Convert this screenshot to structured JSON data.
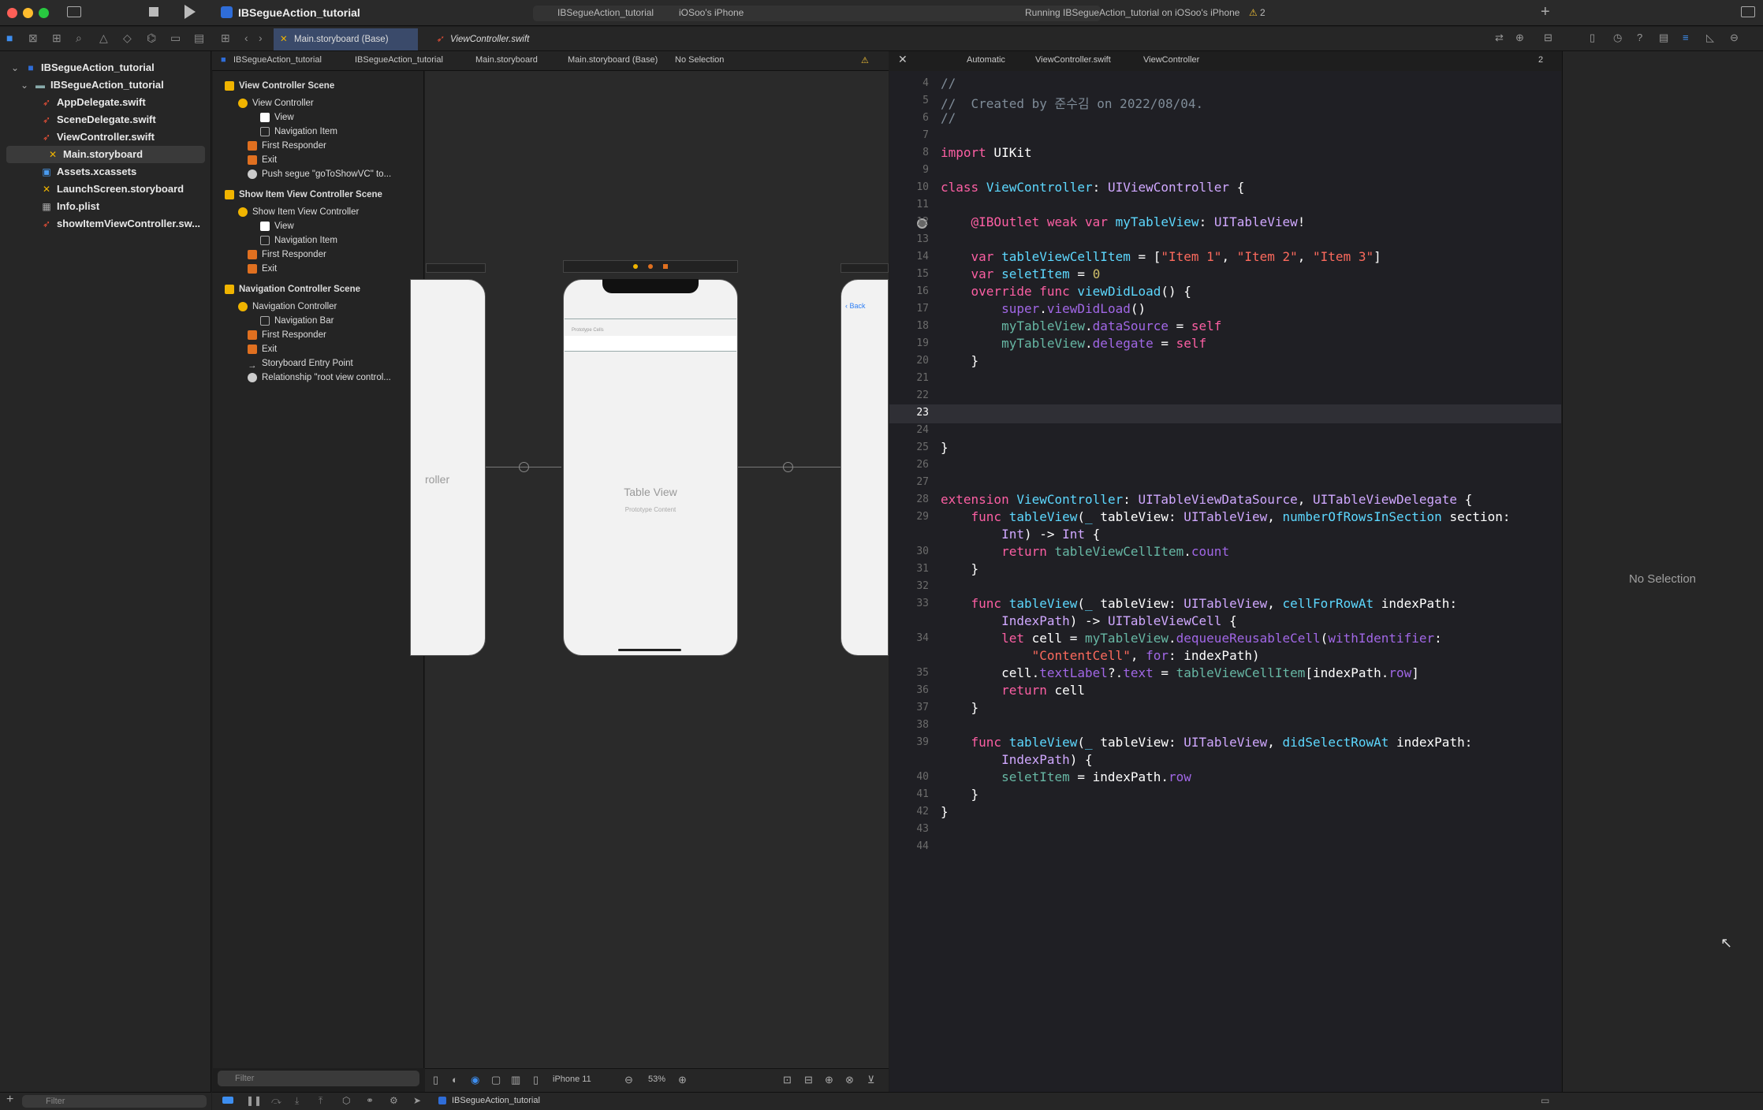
{
  "window": {
    "project_name": "IBSegueAction_tutorial",
    "scheme": "IBSegueAction_tutorial",
    "device": "iOSoo's iPhone",
    "status": "Running IBSegueAction_tutorial on iOSoo's iPhone",
    "warning_count": "2"
  },
  "tabs": [
    {
      "label": "Main.storyboard (Base)"
    },
    {
      "label": "ViewController.swift"
    }
  ],
  "navigator": {
    "items": [
      {
        "label": "IBSegueAction_tutorial"
      },
      {
        "label": "IBSegueAction_tutorial"
      },
      {
        "label": "AppDelegate.swift"
      },
      {
        "label": "SceneDelegate.swift"
      },
      {
        "label": "ViewController.swift"
      },
      {
        "label": "Main.storyboard"
      },
      {
        "label": "Assets.xcassets"
      },
      {
        "label": "LaunchScreen.storyboard"
      },
      {
        "label": "Info.plist"
      },
      {
        "label": "showItemViewController.sw..."
      }
    ],
    "filter_placeholder": "Filter"
  },
  "left_breadcrumb": {
    "items": [
      "IBSegueAction_tutorial",
      "IBSegueAction_tutorial",
      "Main.storyboard",
      "Main.storyboard (Base)",
      "No Selection"
    ]
  },
  "right_breadcrumb": {
    "items": [
      "Automatic",
      "ViewController.swift",
      "ViewController"
    ],
    "counter": "2"
  },
  "outline": {
    "rows": [
      {
        "label": "View Controller Scene"
      },
      {
        "label": "View Controller"
      },
      {
        "label": "View"
      },
      {
        "label": "Navigation Item"
      },
      {
        "label": "First Responder"
      },
      {
        "label": "Exit"
      },
      {
        "label": "Push segue \"goToShowVC\" to..."
      },
      {
        "label": "Show Item View Controller Scene"
      },
      {
        "label": "Show Item View Controller"
      },
      {
        "label": "View"
      },
      {
        "label": "Navigation Item"
      },
      {
        "label": "First Responder"
      },
      {
        "label": "Exit"
      },
      {
        "label": "Navigation Controller Scene"
      },
      {
        "label": "Navigation Controller"
      },
      {
        "label": "Navigation Bar"
      },
      {
        "label": "First Responder"
      },
      {
        "label": "Exit"
      },
      {
        "label": "Storyboard Entry Point"
      },
      {
        "label": "Relationship \"root view control..."
      }
    ],
    "filter_placeholder": "Filter"
  },
  "canvas": {
    "left_phone_label": "roller",
    "table_view_title": "Table View",
    "table_view_subtitle": "Prototype Content",
    "prototype_cells": "Prototype Cells",
    "back_label": "Back",
    "device_label": "iPhone 11",
    "zoom": "53%"
  },
  "code": {
    "line_numbers": [
      "4",
      "5",
      "6",
      "7",
      "8",
      "9",
      "10",
      "11",
      "12",
      "13",
      "14",
      "15",
      "16",
      "17",
      "18",
      "19",
      "20",
      "21",
      "22",
      "23",
      "24",
      "25",
      "26",
      "27",
      "28",
      "29",
      "",
      "30",
      "31",
      "32",
      "33",
      "",
      "34",
      "",
      "35",
      "36",
      "37",
      "38",
      "39",
      "",
      "40",
      "41",
      "42",
      "43",
      "44"
    ]
  },
  "inspector": {
    "empty_label": "No Selection"
  },
  "bottom": {
    "scheme_label": "IBSegueAction_tutorial",
    "filter_placeholder": "Filter"
  }
}
